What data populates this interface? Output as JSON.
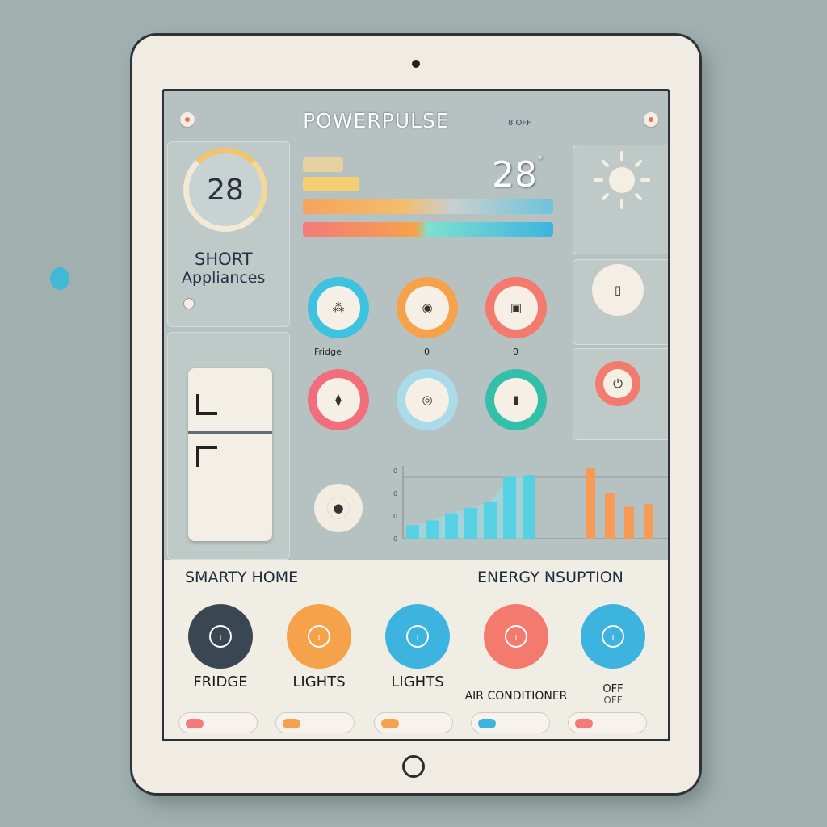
{
  "app": {
    "title": "POWERPULSE",
    "subtitle": "8 OFF"
  },
  "status": {
    "left": "",
    "center": "",
    "right": ""
  },
  "gauge": {
    "value": "28"
  },
  "short": {
    "title": "SHORT",
    "subtitle": "Appliances"
  },
  "weather": {
    "temp": "28",
    "deg": "°",
    "label": ""
  },
  "grid": {
    "labels": [
      "Fridge",
      "0",
      "0"
    ]
  },
  "chart_data": {
    "type": "bar",
    "title": "",
    "categories": [
      "",
      "",
      "",
      "",
      "",
      "",
      ""
    ],
    "values": [
      15,
      20,
      28,
      34,
      40,
      68,
      70
    ],
    "series2": [
      78,
      50,
      35,
      38
    ],
    "ylim": [
      0,
      80
    ],
    "yticks": [
      "0",
      "0",
      "0",
      "0"
    ],
    "xlabel": "",
    "ylabel": ""
  },
  "sections": {
    "left": "SMARTY HOME",
    "right": "ENERGY NSUPTION"
  },
  "devices": [
    {
      "name": "FRIDGE",
      "sub": "",
      "color": "#3a4651",
      "pill_color": "#f47a7a"
    },
    {
      "name": "LIGHTS",
      "sub": "",
      "color": "#f6a24b",
      "pill_color": "#f6a24b"
    },
    {
      "name": "LIGHTS",
      "sub": "",
      "color": "#3db3df",
      "pill_color": "#f6a24b"
    },
    {
      "name": "AIR CONDITIONER",
      "sub": "",
      "color": "#f47a6e",
      "pill_color": "#3db3df"
    },
    {
      "name": "OFF",
      "sub": "OFF",
      "color": "#3db3df",
      "pill_color": "#f47a7a"
    }
  ],
  "colors": {
    "accent": "#3db3df",
    "warn": "#f47a6e",
    "orange": "#f6a24b"
  }
}
